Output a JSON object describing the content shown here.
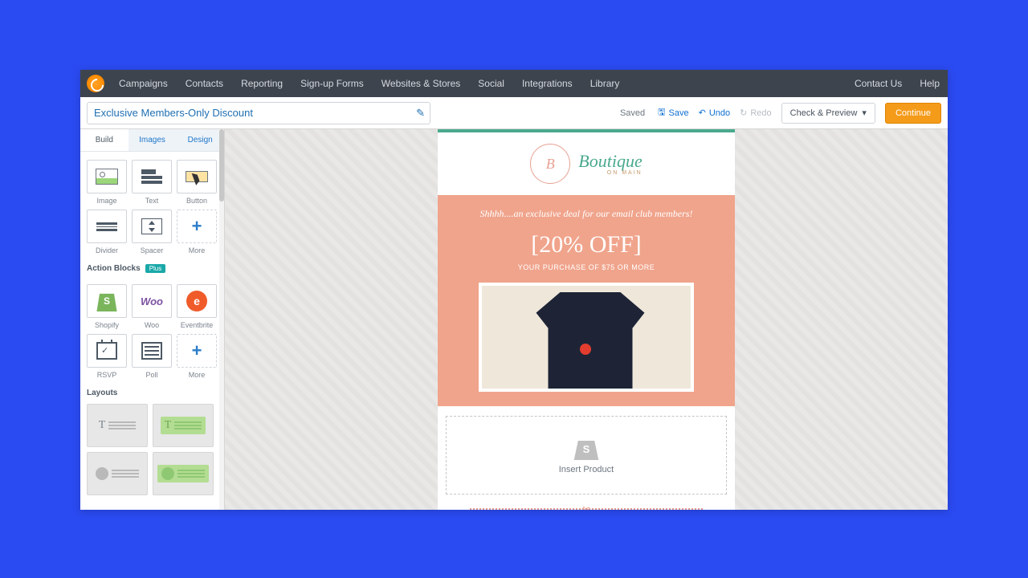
{
  "nav": {
    "items": [
      "Campaigns",
      "Contacts",
      "Reporting",
      "Sign-up Forms",
      "Websites & Stores",
      "Social",
      "Integrations",
      "Library"
    ],
    "right": [
      "Contact Us",
      "Help"
    ]
  },
  "toolbar": {
    "campaign_name": "Exclusive Members-Only Discount",
    "status": "Saved",
    "save": "Save",
    "undo": "Undo",
    "redo": "Redo",
    "check_preview": "Check & Preview",
    "continue": "Continue"
  },
  "sidebar": {
    "tabs": [
      "Build",
      "Images",
      "Design"
    ],
    "active_tab": 0,
    "blocks": [
      {
        "label": "Image",
        "icon": "image"
      },
      {
        "label": "Text",
        "icon": "text"
      },
      {
        "label": "Button",
        "icon": "button"
      },
      {
        "label": "Divider",
        "icon": "divider"
      },
      {
        "label": "Spacer",
        "icon": "spacer"
      },
      {
        "label": "More",
        "icon": "more",
        "dashed": true
      }
    ],
    "action_title": "Action Blocks",
    "action_badge": "Plus",
    "action_blocks": [
      {
        "label": "Shopify",
        "icon": "shopify"
      },
      {
        "label": "Woo",
        "icon": "woo"
      },
      {
        "label": "Eventbrite",
        "icon": "event"
      },
      {
        "label": "RSVP",
        "icon": "rsvp"
      },
      {
        "label": "Poll",
        "icon": "poll"
      },
      {
        "label": "More",
        "icon": "more",
        "dashed": true
      }
    ],
    "layout_title": "Layouts"
  },
  "email": {
    "brand": "Boutique",
    "brand_sub": "ON MAIN",
    "exclusive": "Shhhh....an exclusive deal for our email club members!",
    "offer": "[20% OFF]",
    "condition": "YOUR PURCHASE OF $75 OR MORE",
    "insert_label": "Insert Product"
  }
}
